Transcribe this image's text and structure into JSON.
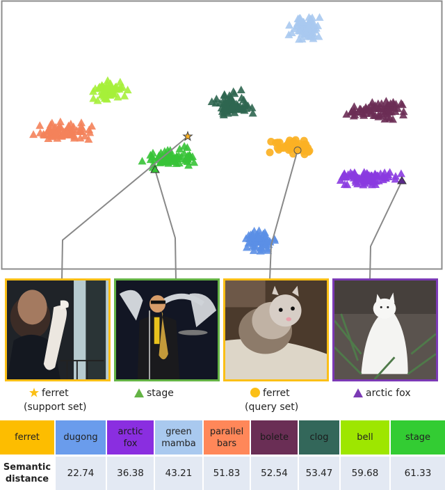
{
  "chart_data": {
    "type": "scatter",
    "title": "",
    "description": "t-SNE style embedding of class features: ferret query set (circles), ferret support set (star), and triangles for other classes",
    "xlabel": "",
    "ylabel": "",
    "grid": false,
    "axes_visible": false,
    "series": [
      {
        "name": "green mamba",
        "marker": "triangle",
        "color": "#a9c9ef",
        "center": [
          440,
          40
        ],
        "spread": [
          32,
          22
        ],
        "count": 70
      },
      {
        "name": "bell",
        "marker": "triangle",
        "color": "#a6f03a",
        "center": [
          155,
          130
        ],
        "spread": [
          32,
          18
        ],
        "count": 55
      },
      {
        "name": "parallel bars",
        "marker": "triangle",
        "color": "#f4825a",
        "center": [
          90,
          190
        ],
        "spread": [
          55,
          16
        ],
        "count": 75
      },
      {
        "name": "clog",
        "marker": "triangle",
        "color": "#2f6650",
        "center": [
          335,
          150
        ],
        "spread": [
          35,
          26
        ],
        "count": 65
      },
      {
        "name": "bolete",
        "marker": "triangle",
        "color": "#6b2e55",
        "center": [
          545,
          158
        ],
        "spread": [
          58,
          18
        ],
        "count": 75
      },
      {
        "name": "stage",
        "marker": "triangle",
        "color": "#37c337",
        "center": [
          245,
          225
        ],
        "spread": [
          50,
          18
        ],
        "count": 75
      },
      {
        "name": "arctic fox",
        "marker": "triangle",
        "color": "#8a3be0",
        "center": [
          525,
          255
        ],
        "spread": [
          62,
          14
        ],
        "count": 80
      },
      {
        "name": "dugong",
        "marker": "triangle",
        "color": "#5b8fe6",
        "center": [
          375,
          345
        ],
        "spread": [
          32,
          22
        ],
        "count": 60
      },
      {
        "name": "ferret (query set)",
        "marker": "circle",
        "color": "#fbb124",
        "center": [
          420,
          210
        ],
        "spread": [
          38,
          16
        ],
        "count": 45
      },
      {
        "name": "ferret (support set)",
        "marker": "star",
        "color": "#fbb124",
        "center": [
          270,
          196
        ],
        "spread": [
          0,
          0
        ],
        "count": 1
      }
    ],
    "callouts": [
      {
        "label": "ferret (support set)",
        "image": "man holding white ferret",
        "frame_color": "#fbbf16"
      },
      {
        "label": "stage",
        "image": "saxophone player on stage",
        "frame_color": "#64b345"
      },
      {
        "label": "ferret (query set)",
        "image": "ferret on carpet",
        "frame_color": "#fbbf16"
      },
      {
        "label": "arctic fox",
        "image": "white arctic fox among pine branches",
        "frame_color": "#7b3ab5"
      }
    ],
    "table": {
      "row_label": "Semantic distance",
      "columns": [
        "ferret",
        "dugong",
        "arctic fox",
        "green mamba",
        "parallel bars",
        "bolete",
        "clog",
        "bell",
        "stage"
      ],
      "values": [
        null,
        22.74,
        36.38,
        43.21,
        51.83,
        52.54,
        53.47,
        59.68,
        61.33
      ]
    }
  },
  "legend": [
    {
      "symbol": "star",
      "color": "#fbbf16",
      "label": "ferret",
      "sublabel": "(support set)"
    },
    {
      "symbol": "triangle",
      "color": "#64b345",
      "label": "stage",
      "sublabel": ""
    },
    {
      "symbol": "circle",
      "color": "#fbbf16",
      "label": "ferret",
      "sublabel": "(query set)"
    },
    {
      "symbol": "triangle",
      "color": "#7b3ab5",
      "label": "arctic fox",
      "sublabel": ""
    }
  ],
  "table": {
    "row_label": "Semantic distance",
    "headers": [
      {
        "label": "ferret",
        "color": "#fdbd00"
      },
      {
        "label": "dugong",
        "color": "#6a9cec"
      },
      {
        "label": "arctic fox",
        "color": "#8a2ee0"
      },
      {
        "label": "green mamba",
        "color": "#a9c9ef"
      },
      {
        "label": "parallel bars",
        "color": "#ff8759"
      },
      {
        "label": "bolete",
        "color": "#6a2e55"
      },
      {
        "label": "clog",
        "color": "#33675a"
      },
      {
        "label": "bell",
        "color": "#9ee600"
      },
      {
        "label": "stage",
        "color": "#33cc33"
      }
    ],
    "values": [
      "",
      "22.74",
      "36.38",
      "43.21",
      "51.83",
      "52.54",
      "53.47",
      "59.68",
      "61.33"
    ]
  }
}
